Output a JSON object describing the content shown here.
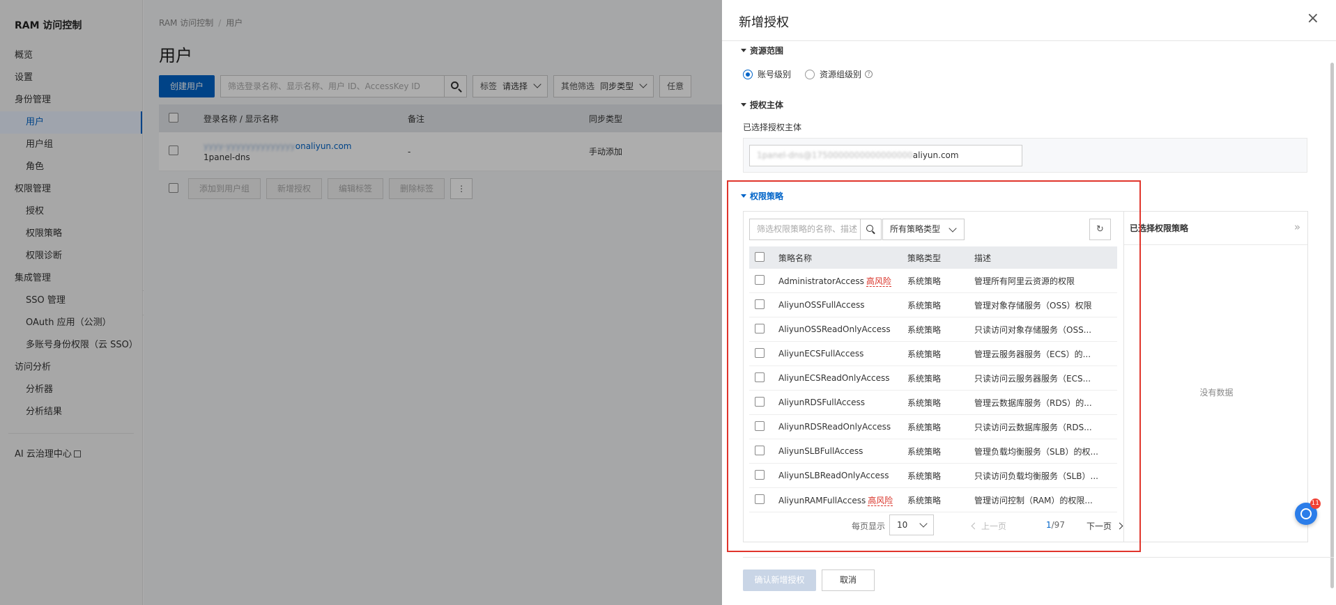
{
  "sidebar": {
    "title": "RAM 访问控制",
    "items": [
      {
        "label": "概览",
        "level": 0,
        "active": false
      },
      {
        "label": "设置",
        "level": 0,
        "active": false
      },
      {
        "label": "身份管理",
        "level": 0,
        "active": false
      },
      {
        "label": "用户",
        "level": 1,
        "active": true
      },
      {
        "label": "用户组",
        "level": 1,
        "active": false
      },
      {
        "label": "角色",
        "level": 1,
        "active": false
      },
      {
        "label": "权限管理",
        "level": 0,
        "active": false
      },
      {
        "label": "授权",
        "level": 1,
        "active": false
      },
      {
        "label": "权限策略",
        "level": 1,
        "active": false
      },
      {
        "label": "权限诊断",
        "level": 1,
        "active": false
      },
      {
        "label": "集成管理",
        "level": 0,
        "active": false
      },
      {
        "label": "SSO 管理",
        "level": 1,
        "active": false
      },
      {
        "label": "OAuth 应用（公测）",
        "level": 1,
        "active": false
      },
      {
        "label": "多账号身份权限（云 SSO）",
        "level": 1,
        "active": false
      },
      {
        "label": "访问分析",
        "level": 0,
        "active": false
      },
      {
        "label": "分析器",
        "level": 1,
        "active": false
      },
      {
        "label": "分析结果",
        "level": 1,
        "active": false
      }
    ],
    "footer_link": "AI 云治理中心"
  },
  "main": {
    "breadcrumb": [
      "RAM 访问控制",
      "用户"
    ],
    "title": "用户",
    "create_button": "创建用户",
    "search_placeholder": "筛选登录名称、显示名称、用户 ID、AccessKey ID",
    "filter_tag_label": "标签",
    "filter_tag_value": "请选择",
    "filter_other_label": "其他筛选",
    "filter_other_value": "同步类型",
    "filter_any": "任意",
    "columns": [
      "登录名称 / 显示名称",
      "备注",
      "同步类型"
    ],
    "rows": [
      {
        "login_suffix": "onaliyun.com",
        "display": "1panel-dns",
        "note": "-",
        "sync": "手动添加"
      }
    ],
    "batch_buttons": [
      "添加到用户组",
      "新增授权",
      "编辑标签",
      "删除标签"
    ],
    "more_label": "⋮"
  },
  "drawer": {
    "title": "新增授权",
    "close_label": "×",
    "resource_scope": {
      "heading": "资源范围",
      "options": [
        {
          "label": "账号级别",
          "selected": true
        },
        {
          "label": "资源组级别",
          "selected": false
        }
      ],
      "help": "?"
    },
    "principal": {
      "heading": "授权主体",
      "label": "已选择授权主体",
      "value_visible": "aliyun.com"
    },
    "policy": {
      "heading": "权限策略",
      "search_placeholder": "筛选权限策略的名称、描述",
      "type_select": "所有策略类型",
      "refresh_label": "↻",
      "columns": [
        "策略名称",
        "策略类型",
        "描述"
      ],
      "rows": [
        {
          "name": "AdministratorAccess",
          "risk": "高风险",
          "type": "系统策略",
          "desc": "管理所有阿里云资源的权限"
        },
        {
          "name": "AliyunOSSFullAccess",
          "risk": "",
          "type": "系统策略",
          "desc": "管理对象存储服务（OSS）权限"
        },
        {
          "name": "AliyunOSSReadOnlyAccess",
          "risk": "",
          "type": "系统策略",
          "desc": "只读访问对象存储服务（OSS..."
        },
        {
          "name": "AliyunECSFullAccess",
          "risk": "",
          "type": "系统策略",
          "desc": "管理云服务器服务（ECS）的..."
        },
        {
          "name": "AliyunECSReadOnlyAccess",
          "risk": "",
          "type": "系统策略",
          "desc": "只读访问云服务器服务（ECS..."
        },
        {
          "name": "AliyunRDSFullAccess",
          "risk": "",
          "type": "系统策略",
          "desc": "管理云数据库服务（RDS）的..."
        },
        {
          "name": "AliyunRDSReadOnlyAccess",
          "risk": "",
          "type": "系统策略",
          "desc": "只读访问云数据库服务（RDS..."
        },
        {
          "name": "AliyunSLBFullAccess",
          "risk": "",
          "type": "系统策略",
          "desc": "管理负载均衡服务（SLB）的权..."
        },
        {
          "name": "AliyunSLBReadOnlyAccess",
          "risk": "",
          "type": "系统策略",
          "desc": "只读访问负载均衡服务（SLB）..."
        },
        {
          "name": "AliyunRAMFullAccess",
          "risk": "高风险",
          "type": "系统策略",
          "desc": "管理访问控制（RAM）的权限..."
        }
      ],
      "pagination": {
        "page_size_label": "每页显示",
        "page_size": "10",
        "prev": "上一页",
        "current": "1",
        "total": "/97",
        "next": "下一页"
      }
    },
    "selected": {
      "title": "已选择权限策略",
      "expand_label": "»",
      "empty": "没有数据"
    },
    "confirm_button": "确认新增授权",
    "cancel_button": "取消",
    "help_badge": "11"
  },
  "colors": {
    "primary": "#0064c8",
    "risk": "#d93026",
    "highlight_border": "#e0342b"
  }
}
